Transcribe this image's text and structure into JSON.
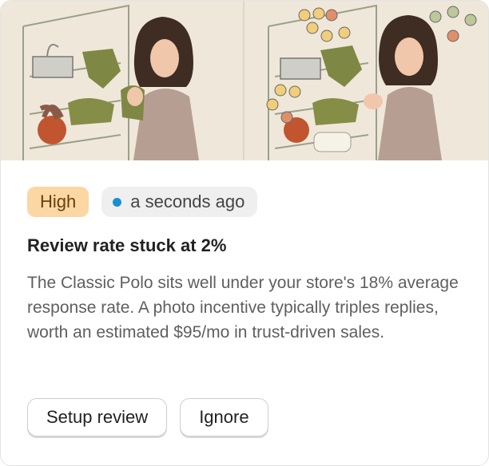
{
  "insight": {
    "priority": "High",
    "time": "a seconds ago",
    "title": "Review rate stuck at 2%",
    "description": "The Classic Polo sits well under your store's 18% average response rate. A photo incentive typically triples replies, worth an estimated $95/mo in trust-driven sales.",
    "status_dot_color": "#1a8fd6"
  },
  "actions": {
    "primary": "Setup review",
    "secondary": "Ignore"
  }
}
